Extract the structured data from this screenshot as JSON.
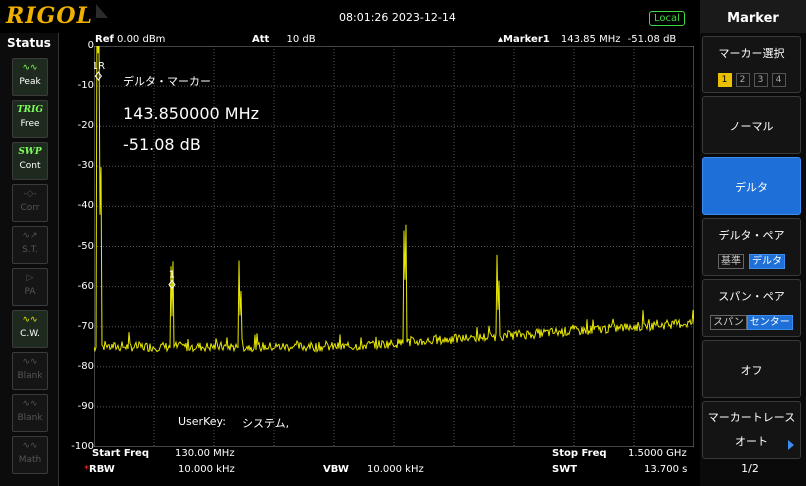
{
  "brand": "RIGOL",
  "datetime": "08:01:26 2023-12-14",
  "local_label": "Local",
  "status": {
    "title": "Status",
    "items": [
      {
        "name": "peak",
        "label": "Peak",
        "state": "on"
      },
      {
        "name": "trig",
        "label": "Free",
        "top": "TRIG",
        "state": "on"
      },
      {
        "name": "swp",
        "label": "Cont",
        "top": "SWP",
        "state": "on"
      },
      {
        "name": "corr",
        "label": "Corr",
        "state": "off"
      },
      {
        "name": "st",
        "label": "S.T.",
        "state": "off"
      },
      {
        "name": "pa",
        "label": "PA",
        "state": "off"
      },
      {
        "name": "cw",
        "label": "C.W.",
        "state": "yel"
      },
      {
        "name": "blank1",
        "label": "Blank",
        "state": "off"
      },
      {
        "name": "blank2",
        "label": "Blank",
        "state": "off"
      },
      {
        "name": "math",
        "label": "Math",
        "state": "off"
      }
    ]
  },
  "header": {
    "ref_label": "Ref",
    "ref_value": "0.00 dBm",
    "att_label": "Att",
    "att_value": "10 dB",
    "marker_label": "▴Marker1",
    "marker_freq": "143.85 MHz",
    "marker_level": "-51.08 dB"
  },
  "marker_readout": {
    "title": "デルタ・マーカー",
    "freq": "143.850000 MHz",
    "level": "-51.08 dB",
    "ref_tag": "1R",
    "marker_tag": "1"
  },
  "userkey": {
    "label": "UserKey:",
    "value": "システム,"
  },
  "footer": {
    "start_label": "Start Freq",
    "start_value": "130.00 MHz",
    "stop_label": "Stop Freq",
    "stop_value": "1.5000 GHz",
    "rbw_label": "RBW",
    "rbw_star": "*",
    "rbw_value": "10.000 kHz",
    "vbw_label": "VBW",
    "vbw_value": "10.000 kHz",
    "swt_label": "SWT",
    "swt_value": "13.700 s"
  },
  "right_panel": {
    "title": "Marker",
    "select_label": "マーカー選択",
    "select_numbers": [
      "1",
      "2",
      "3",
      "4"
    ],
    "normal_label": "ノーマル",
    "delta_label": "デルタ",
    "delta_pair_label": "デルタ・ペア",
    "delta_pair_opts": [
      "基準",
      "デルタ"
    ],
    "span_pair_label": "スパン・ペア",
    "span_pair_opts": [
      "スパン",
      "センター"
    ],
    "off_label": "オフ",
    "trace_label": "マーカートレース",
    "trace_value": "オート",
    "page": "1/2"
  },
  "chart_data": {
    "type": "line",
    "xlabel": "",
    "ylabel": "",
    "xlim": [
      130,
      1500
    ],
    "ylim": [
      -100,
      0
    ],
    "x_unit": "MHz",
    "y_unit": "dB",
    "yticks": [
      0,
      -10,
      -20,
      -30,
      -40,
      -50,
      -60,
      -70,
      -80,
      -90,
      -100
    ],
    "trace_color": "#e8e800",
    "grid": true,
    "noise_floor": {
      "start": -75,
      "end": -69
    },
    "peaks": [
      {
        "x": 140,
        "y": -7
      },
      {
        "x": 143.85,
        "y": -43
      },
      {
        "x": 308,
        "y": -68
      },
      {
        "x": 464,
        "y": -71
      },
      {
        "x": 840,
        "y": -59
      },
      {
        "x": 1053,
        "y": -69
      }
    ],
    "markers": [
      {
        "tag": "1R",
        "x": 140,
        "y": -7.5
      },
      {
        "tag": "1",
        "x": 308,
        "y": -59.5
      }
    ]
  }
}
